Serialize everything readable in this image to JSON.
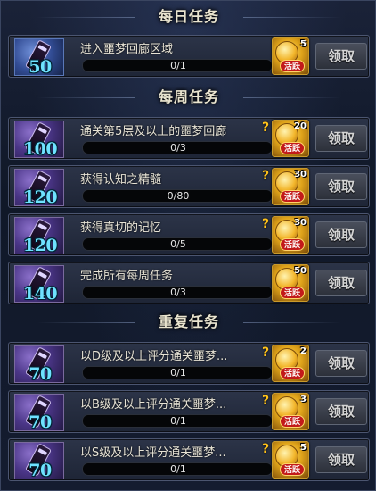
{
  "sections": [
    {
      "title": "每日任务",
      "items": [
        {
          "title": "进入噩梦回廊区域",
          "level": "50",
          "progress_text": "0/1",
          "progress": 0,
          "reward_count": "5",
          "reward_label": "活跃",
          "claim_label": "领取",
          "help": false,
          "icon_theme": "blue"
        }
      ]
    },
    {
      "title": "每周任务",
      "items": [
        {
          "title": "通关第5层及以上的噩梦回廊",
          "level": "100",
          "progress_text": "0/3",
          "progress": 0,
          "reward_count": "20",
          "reward_label": "活跃",
          "claim_label": "领取",
          "help": true,
          "icon_theme": "purple"
        },
        {
          "title": "获得认知之精髓",
          "level": "120",
          "progress_text": "0/80",
          "progress": 0,
          "reward_count": "30",
          "reward_label": "活跃",
          "claim_label": "领取",
          "help": true,
          "icon_theme": "purple"
        },
        {
          "title": "获得真切的记忆",
          "level": "120",
          "progress_text": "0/5",
          "progress": 0,
          "reward_count": "30",
          "reward_label": "活跃",
          "claim_label": "领取",
          "help": true,
          "icon_theme": "purple"
        },
        {
          "title": "完成所有每周任务",
          "level": "140",
          "progress_text": "0/3",
          "progress": 0,
          "reward_count": "50",
          "reward_label": "活跃",
          "claim_label": "领取",
          "help": false,
          "icon_theme": "purple"
        }
      ]
    },
    {
      "title": "重复任务",
      "items": [
        {
          "title": "以D级及以上评分通关噩梦...",
          "level": "70",
          "progress_text": "0/1",
          "progress": 0,
          "reward_count": "2",
          "reward_label": "活跃",
          "claim_label": "领取",
          "help": true,
          "icon_theme": "purple"
        },
        {
          "title": "以B级及以上评分通关噩梦...",
          "level": "70",
          "progress_text": "0/1",
          "progress": 0,
          "reward_count": "3",
          "reward_label": "活跃",
          "claim_label": "领取",
          "help": true,
          "icon_theme": "purple"
        },
        {
          "title": "以S级及以上评分通关噩梦...",
          "level": "70",
          "progress_text": "0/1",
          "progress": 0,
          "reward_count": "5",
          "reward_label": "活跃",
          "claim_label": "领取",
          "help": true,
          "icon_theme": "purple"
        }
      ]
    }
  ],
  "colors": {
    "level_text": "#6ee2ff",
    "help_icon": "#ffc21a",
    "reward_badge": "#c21a1a"
  },
  "icons": {
    "task": "wand-scroll-icon",
    "help": "question-icon",
    "reward": "activity-medal-icon"
  }
}
